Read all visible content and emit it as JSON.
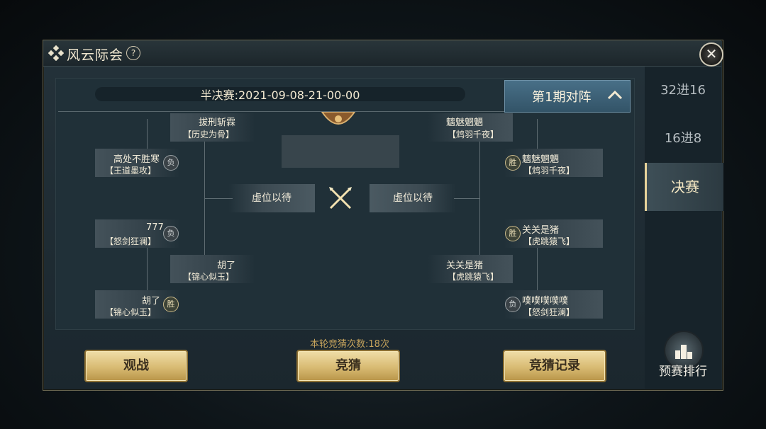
{
  "window": {
    "title": "风云际会",
    "help": "?",
    "close": "✕"
  },
  "header": {
    "round_datetime": "半决赛:2021-09-08-21-00-00",
    "period_label": "第1期对阵"
  },
  "side_tabs": [
    "32进16",
    "16进8",
    "决赛"
  ],
  "bracket": {
    "left": [
      {
        "name": "拔刑斩霖",
        "guild": "【历史为骨】",
        "badge": ""
      },
      {
        "name": "高处不胜寒",
        "guild": "【王道墨攻】",
        "badge": "负"
      },
      {
        "name": "777",
        "guild": "【怒剑狂澜】",
        "badge": "负"
      },
      {
        "name": "胡了",
        "guild": "【锦心似玉】",
        "badge": ""
      },
      {
        "name": "胡了",
        "guild": "【锦心似玉】",
        "badge": "胜"
      }
    ],
    "right": [
      {
        "name": "魑魅魍魉",
        "guild": "【鸩羽千夜】",
        "badge": ""
      },
      {
        "name": "魑魅魍魉",
        "guild": "【鸩羽千夜】",
        "badge": "胜"
      },
      {
        "name": "关关是猪",
        "guild": "【虎跳猿飞】",
        "badge": "胜"
      },
      {
        "name": "关关是猪",
        "guild": "【虎跳猿飞】",
        "badge": ""
      },
      {
        "name": "噗噗噗噗噗",
        "guild": "【怒剑狂澜】",
        "badge": "负"
      }
    ],
    "final_left": "虚位以待",
    "final_right": "虚位以待"
  },
  "footer": {
    "guess_count": "本轮竞猜次数:18次",
    "watch": "观战",
    "guess": "竞猜",
    "guess_record": "竞猜记录",
    "ranking": "预赛排行"
  },
  "colors": {
    "gold": "#d8bb73",
    "accent_text": "#c7a45c",
    "panel": "#203038"
  }
}
